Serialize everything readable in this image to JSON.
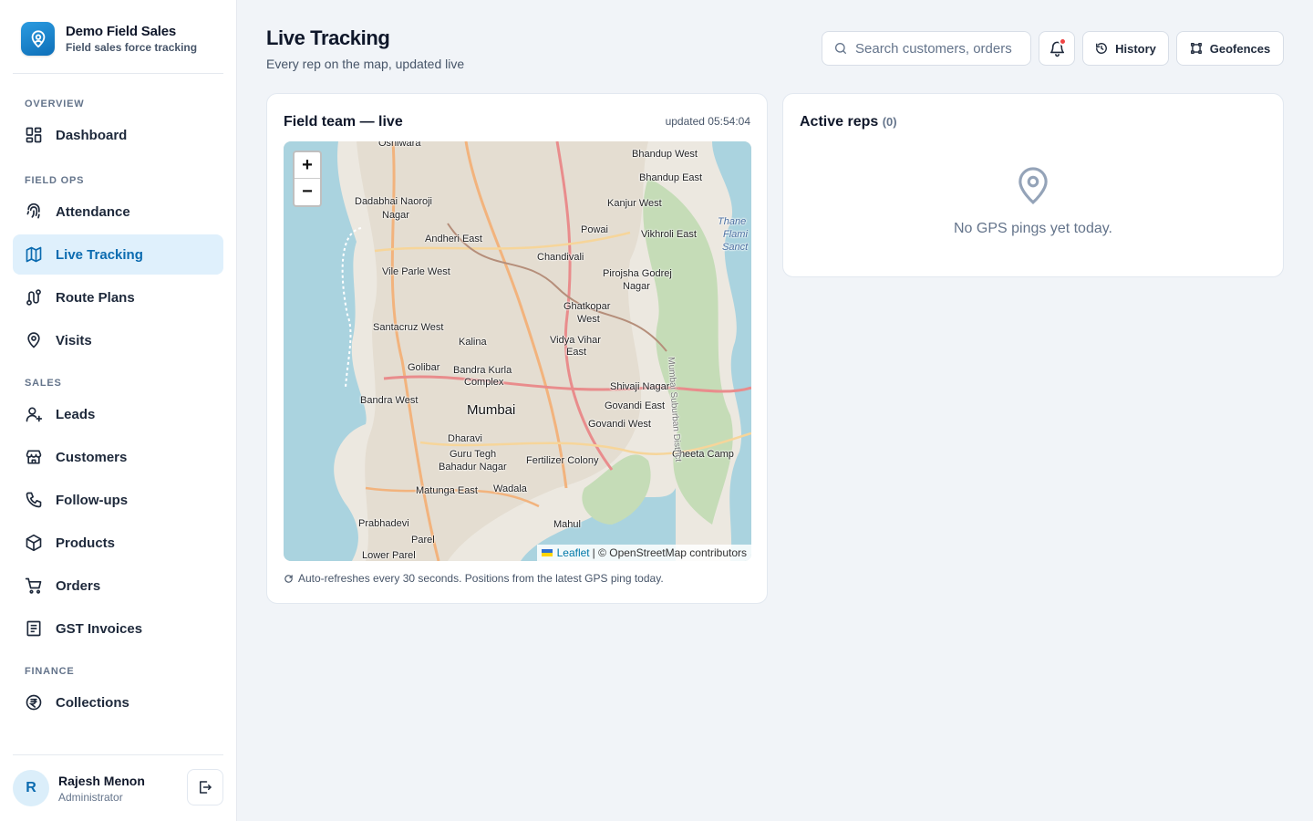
{
  "brand": {
    "title": "Demo Field Sales",
    "subtitle": "Field sales force tracking"
  },
  "sidebar": {
    "sections": [
      {
        "label": "OVERVIEW",
        "items": [
          {
            "label": "Dashboard",
            "icon": "dashboard-icon"
          }
        ]
      },
      {
        "label": "FIELD OPS",
        "items": [
          {
            "label": "Attendance",
            "icon": "fingerprint-icon"
          },
          {
            "label": "Live Tracking",
            "icon": "map-icon",
            "active": true
          },
          {
            "label": "Route Plans",
            "icon": "route-icon"
          },
          {
            "label": "Visits",
            "icon": "map-pin-icon"
          }
        ]
      },
      {
        "label": "SALES",
        "items": [
          {
            "label": "Leads",
            "icon": "user-plus-icon"
          },
          {
            "label": "Customers",
            "icon": "store-icon"
          },
          {
            "label": "Follow-ups",
            "icon": "phone-icon"
          },
          {
            "label": "Products",
            "icon": "box-icon"
          },
          {
            "label": "Orders",
            "icon": "cart-icon"
          },
          {
            "label": "GST Invoices",
            "icon": "invoice-icon"
          }
        ]
      },
      {
        "label": "FINANCE",
        "items": [
          {
            "label": "Collections",
            "icon": "rupee-icon"
          }
        ]
      }
    ]
  },
  "user": {
    "initial": "R",
    "name": "Rajesh Menon",
    "role": "Administrator"
  },
  "header": {
    "title": "Live Tracking",
    "subtitle": "Every rep on the map, updated live",
    "search_placeholder": "Search customers, orders",
    "history_label": "History",
    "geofences_label": "Geofences"
  },
  "map_card": {
    "title": "Field team — live",
    "updated": "updated 05:54:04",
    "zoom_in": "+",
    "zoom_out": "−",
    "attribution_leaflet": "Leaflet",
    "attribution_osm": "| © OpenStreetMap contributors",
    "refresh_note": "Auto-refreshes every 30 seconds. Positions from the latest GPS ping today."
  },
  "map_labels": [
    "Oshiwara",
    "Bhandup West",
    "Bhandup East",
    "Dadabhai Naoroji",
    "Nagar",
    "Kanjur West",
    "Thane",
    "Flami",
    "Sanct",
    "Andheri East",
    "Powai",
    "Vikhroli East",
    "Chandivali",
    "Vile Parle West",
    "Pirojsha Godrej",
    "Nagar",
    "Ghatkopar",
    "West",
    "Santacruz West",
    "Kalina",
    "Vidya Vihar",
    "East",
    "Golibar",
    "Bandra Kurla",
    "Complex",
    "Shivaji Nagar",
    "Bandra West",
    "Govandi East",
    "Mumbai",
    "Govandi West",
    "Dharavi",
    "Cheeta Camp",
    "Guru Tegh",
    "Bahadur Nagar",
    "Fertilizer Colony",
    "Matunga East",
    "Wadala",
    "Prabhadevi",
    "Mahul",
    "Parel",
    "Lower Parel",
    "Mumbai Suburban District"
  ],
  "reps_card": {
    "title": "Active reps",
    "count": "(0)",
    "empty_text": "No GPS pings yet today."
  },
  "colors": {
    "accent": "#0b6bb0",
    "active_bg": "#dff0fc",
    "notification": "#ef4444"
  }
}
